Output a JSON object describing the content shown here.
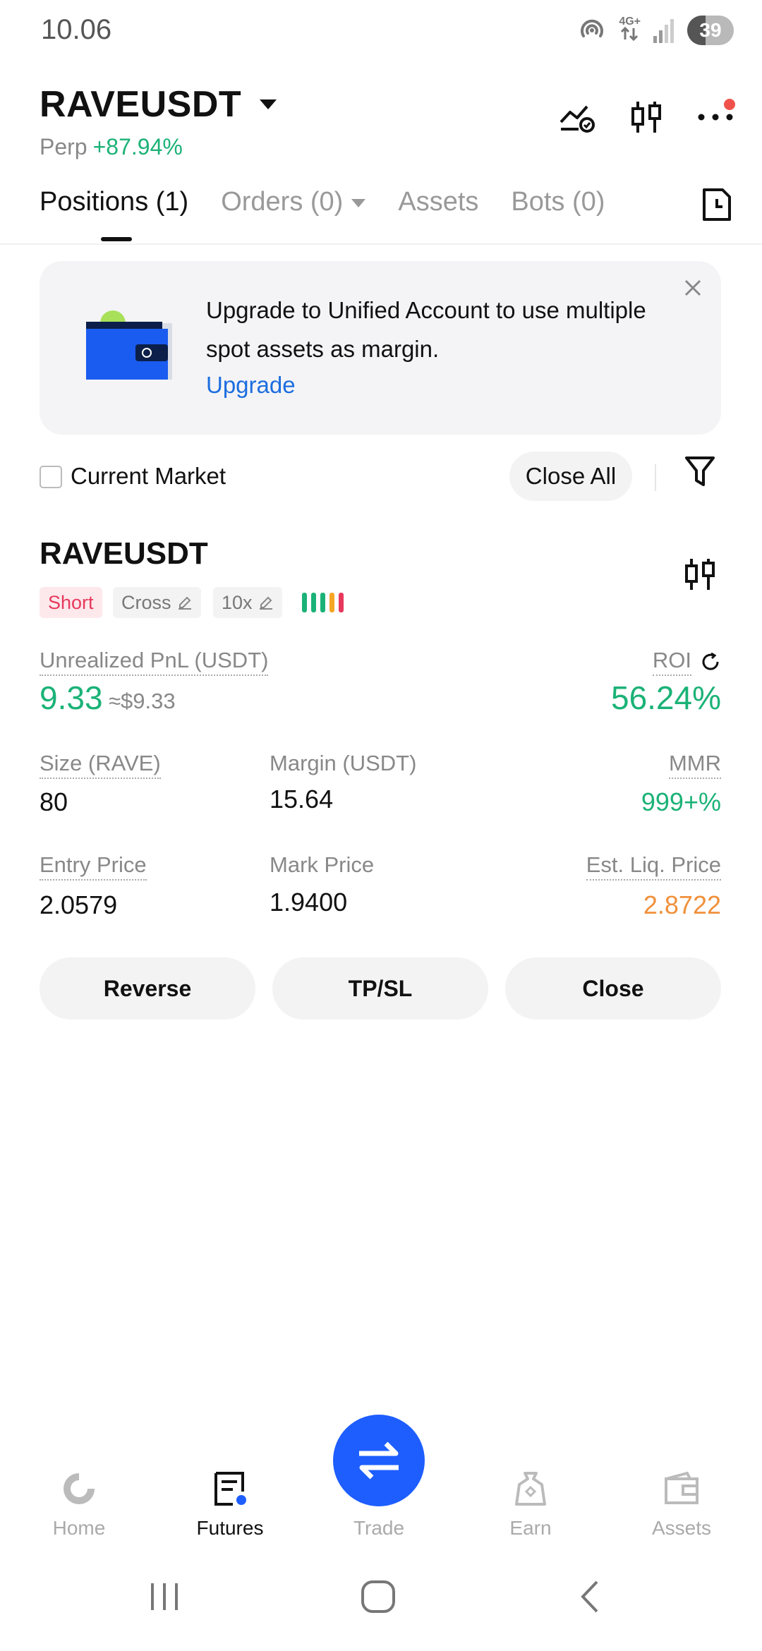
{
  "status_bar": {
    "time": "10.06",
    "network": "4G+",
    "battery": "39"
  },
  "header": {
    "pair": "RAVEUSDT",
    "type": "Perp",
    "change": "+87.94%"
  },
  "tabs": [
    {
      "label": "Positions (1)",
      "active": true
    },
    {
      "label": "Orders (0)"
    },
    {
      "label": "Assets"
    },
    {
      "label": "Bots (0)"
    }
  ],
  "banner": {
    "text": "Upgrade to Unified Account to use multiple spot assets as margin.",
    "link": "Upgrade"
  },
  "filter": {
    "checkbox_label": "Current Market",
    "close_all": "Close All"
  },
  "position": {
    "symbol": "RAVEUSDT",
    "side": "Short",
    "margin_mode": "Cross",
    "leverage": "10x",
    "pnl_label": "Unrealized PnL (USDT)",
    "pnl_value": "9.33",
    "pnl_usd": "≈$9.33",
    "roi_label": "ROI",
    "roi_value": "56.24%",
    "size_label": "Size (RAVE)",
    "size_value": "80",
    "margin_label": "Margin (USDT)",
    "margin_value": "15.64",
    "mmr_label": "MMR",
    "mmr_value": "999+%",
    "entry_label": "Entry Price",
    "entry_value": "2.0579",
    "mark_label": "Mark Price",
    "mark_value": "1.9400",
    "liq_label": "Est. Liq. Price",
    "liq_value": "2.8722",
    "risk_colors": [
      "#1bb277",
      "#1bb277",
      "#1bb277",
      "#f5a623",
      "#e6395c"
    ]
  },
  "actions": {
    "reverse": "Reverse",
    "tpsl": "TP/SL",
    "close": "Close"
  },
  "bottom_nav": {
    "home": "Home",
    "futures": "Futures",
    "trade": "Trade",
    "earn": "Earn",
    "assets": "Assets"
  },
  "colors": {
    "green": "#1bb277",
    "red": "#e6395c",
    "orange": "#f0913c",
    "link_blue": "#1c6ede",
    "fab_blue": "#1e5eff"
  }
}
